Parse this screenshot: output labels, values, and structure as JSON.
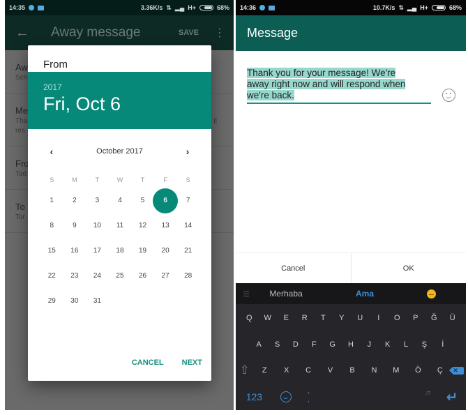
{
  "left": {
    "status": {
      "time": "14:35",
      "speed": "3.36K/s",
      "network": "H+",
      "battery": "68%"
    },
    "toolbar": {
      "back_icon": "←",
      "title": "Away message",
      "save_label": "SAVE",
      "more_icon": "⋮"
    },
    "list": [
      {
        "title": "Aw",
        "subtitle": "Sch"
      },
      {
        "title": "Me",
        "subtitle": "Tha",
        "subtitle2": "res",
        "trailing": "ll"
      },
      {
        "title": "Fro",
        "subtitle": "Tod"
      },
      {
        "title": "To",
        "subtitle": "Tor"
      }
    ],
    "dialog": {
      "title": "From",
      "year": "2017",
      "date": "Fri, Oct 6",
      "month_label": "October 2017",
      "prev_icon": "‹",
      "next_icon": "›",
      "weekdays": [
        "S",
        "M",
        "T",
        "W",
        "T",
        "F",
        "S"
      ],
      "weeks": [
        [
          "",
          "1",
          "2",
          "3",
          "4",
          "5",
          "6",
          "7"
        ],
        [
          "8",
          "9",
          "10",
          "11",
          "12",
          "13",
          "14"
        ],
        [
          "15",
          "16",
          "17",
          "18",
          "19",
          "20",
          "21"
        ],
        [
          "22",
          "23",
          "24",
          "25",
          "26",
          "27",
          "28"
        ],
        [
          "29",
          "30",
          "31",
          "",
          "",
          "",
          ""
        ]
      ],
      "selected_day": "6",
      "cancel_label": "CANCEL",
      "next_label": "NEXT",
      "accent_color": "#07897a"
    }
  },
  "right": {
    "status": {
      "time": "14:36",
      "speed": "10.7K/s",
      "network": "H+",
      "battery": "68%"
    },
    "toolbar": {
      "title": "Message"
    },
    "message": {
      "line1": "Thank you for your message! We're",
      "line2": "away right now and will respond when",
      "line3": "we're back."
    },
    "actions": {
      "cancel_label": "Cancel",
      "ok_label": "OK"
    },
    "keyboard": {
      "suggestions": [
        "Merhaba",
        "Ama"
      ],
      "row1": [
        "Q",
        "W",
        "E",
        "R",
        "T",
        "Y",
        "U",
        "I",
        "O",
        "P",
        "Ğ",
        "Ü"
      ],
      "row2": [
        "A",
        "S",
        "D",
        "F",
        "G",
        "H",
        "J",
        "K",
        "L",
        "Ş",
        "İ"
      ],
      "row3": [
        "Z",
        "X",
        "C",
        "V",
        "B",
        "N",
        "M",
        "Ö",
        "Ç"
      ],
      "numbers_label": "123",
      "comma_label": ",",
      "comma_hint": "🎤",
      "period_label": ".",
      "period_hint": ",!?",
      "accent_color": "#3c8fd6"
    }
  }
}
